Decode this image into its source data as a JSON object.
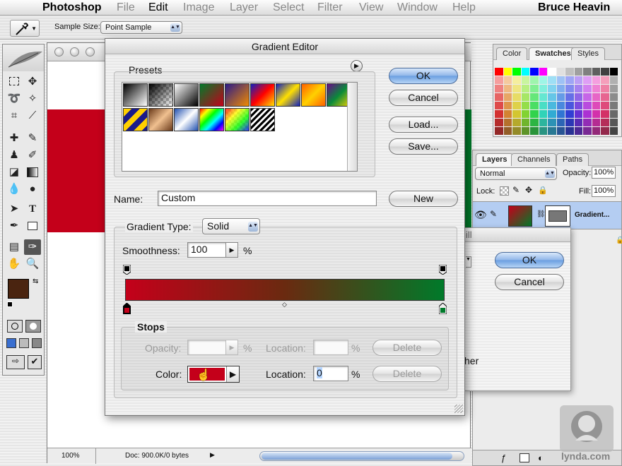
{
  "menubar": {
    "items": [
      "Photoshop",
      "File",
      "Edit",
      "Image",
      "Layer",
      "Select",
      "Filter",
      "View",
      "Window",
      "Help"
    ],
    "user": "Bruce Heavin"
  },
  "options": {
    "sample_size_label": "Sample Size:",
    "sample_size_value": "Point Sample"
  },
  "document": {
    "zoom": "100%",
    "doc_info": "Doc: 900.0K/0 bytes"
  },
  "swatches": {
    "tabs": [
      "Color",
      "Swatches",
      "Styles"
    ]
  },
  "layers": {
    "tabs": [
      "Layers",
      "Channels",
      "Paths"
    ],
    "blend_mode": "Normal",
    "opacity_label": "Opacity:",
    "opacity_value": "100%",
    "lock_label": "Lock:",
    "fill_label": "Fill:",
    "fill_value": "100%",
    "layer_name": "Gradient..."
  },
  "fill_dialog": {
    "ok": "OK",
    "cancel": "Cancel",
    "title_fragment": "ill",
    "partial_text": "her"
  },
  "gradient_editor": {
    "title": "Gradient Editor",
    "presets_label": "Presets",
    "ok": "OK",
    "cancel": "Cancel",
    "load": "Load...",
    "save": "Save...",
    "name_label": "Name:",
    "name_value": "Custom",
    "new": "New",
    "gradient_type_label": "Gradient Type:",
    "gradient_type_value": "Solid",
    "smoothness_label": "Smoothness:",
    "smoothness_value": "100",
    "percent": "%",
    "stops_label": "Stops",
    "opacity_label": "Opacity:",
    "location_label": "Location:",
    "location_value": "0",
    "delete": "Delete",
    "color_label": "Color:"
  },
  "colors": {
    "red": "#c4001a",
    "green": "#007a2a",
    "foreground": "#4a2410",
    "accent": "#6a9ee0"
  },
  "watermark": "lynda.com"
}
